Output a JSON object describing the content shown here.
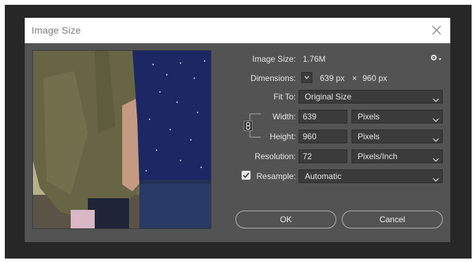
{
  "dialog": {
    "title": "Image Size",
    "image_size_label": "Image Size:",
    "image_size_value": "1.76M",
    "dimensions_label": "Dimensions:",
    "dimensions_width": "639 px",
    "dimensions_times": "×",
    "dimensions_height": "960 px",
    "fit_to_label": "Fit To:",
    "fit_to_value": "Original Size",
    "width_label": "Width:",
    "width_value": "639",
    "width_unit": "Pixels",
    "height_label": "Height:",
    "height_value": "960",
    "height_unit": "Pixels",
    "resolution_label": "Resolution:",
    "resolution_value": "72",
    "resolution_unit": "Pixels/Inch",
    "resample_label": "Resample:",
    "resample_checked": true,
    "resample_value": "Automatic",
    "ok_label": "OK",
    "cancel_label": "Cancel"
  },
  "icons": [
    "close-icon",
    "gear-icon",
    "dimensions-dropdown-icon",
    "chain-link-icon",
    "checkbox-checked-icon",
    "chevron-down-icon"
  ],
  "colors": {
    "dialog_bg": "#535353",
    "titlebar_bg": "#ffffff",
    "field_bg": "#3b3b3b",
    "text": "#e6e6e6",
    "frame": "#272727"
  }
}
